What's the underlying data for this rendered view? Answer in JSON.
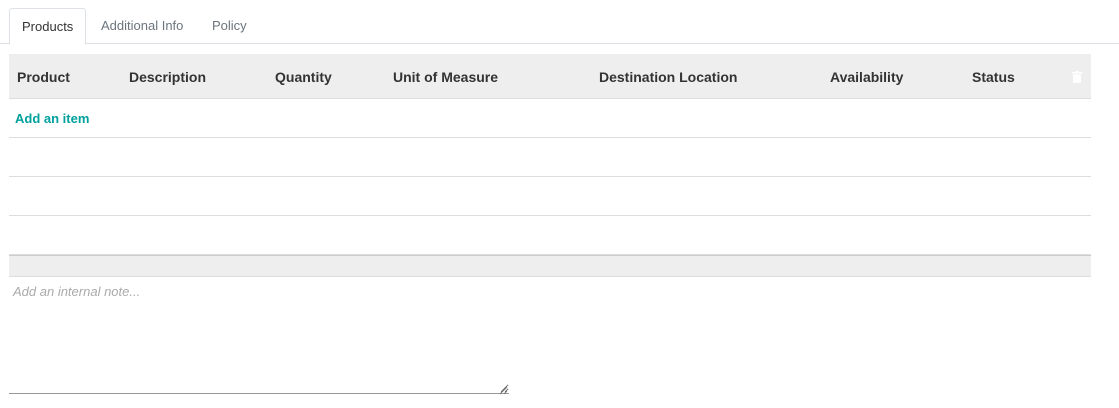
{
  "tabs": [
    {
      "label": "Products",
      "active": true
    },
    {
      "label": "Additional Info",
      "active": false
    },
    {
      "label": "Policy",
      "active": false
    }
  ],
  "table": {
    "columns": [
      "Product",
      "Description",
      "Quantity",
      "Unit of Measure",
      "Destination Location",
      "Availability",
      "Status"
    ],
    "delete_icon": "trash-icon",
    "add_item_label": "Add an item",
    "empty_rows": 3
  },
  "note": {
    "placeholder": "Add an internal note...",
    "value": ""
  },
  "colors": {
    "accent": "#00a09d",
    "header_bg": "#eeeeee"
  }
}
